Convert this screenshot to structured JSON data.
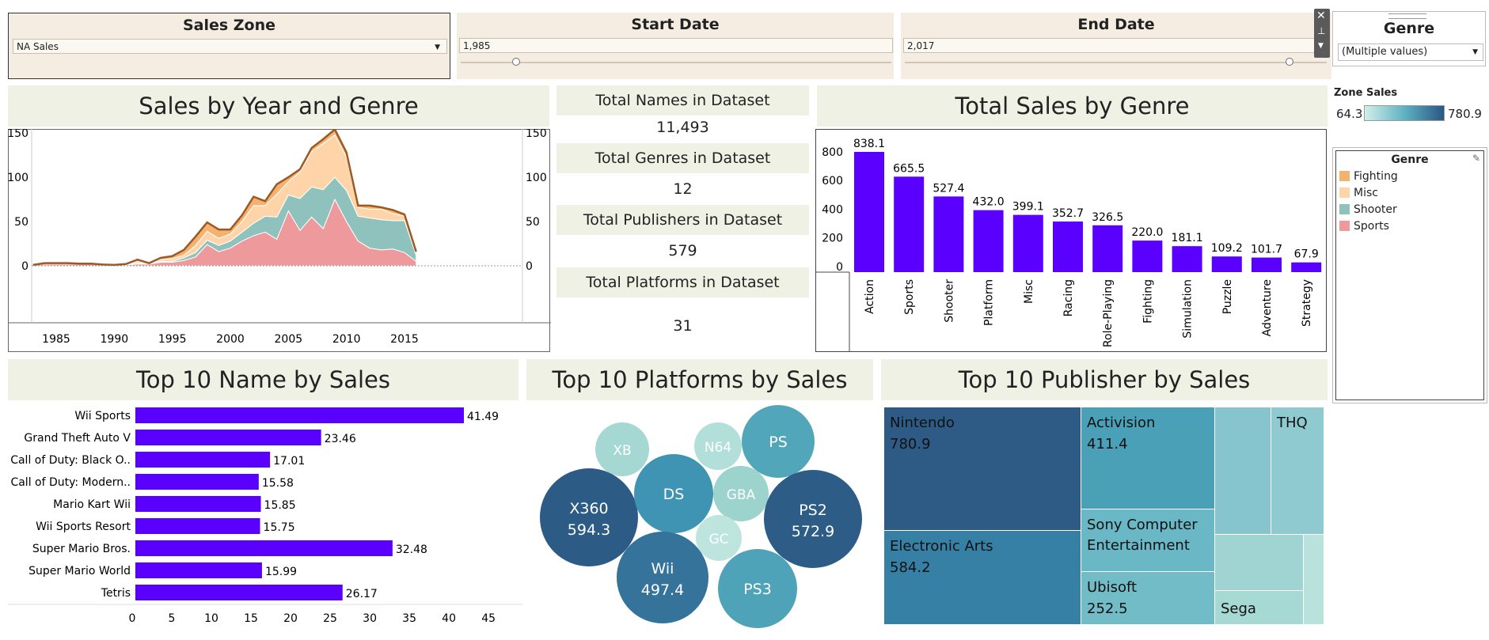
{
  "filters": {
    "sales_zone": {
      "title": "Sales Zone",
      "value": "NA Sales"
    },
    "start_date": {
      "title": "Start Date",
      "value": "1,985"
    },
    "end_date": {
      "title": "End Date",
      "value": "2,017"
    },
    "genre": {
      "title": "Genre",
      "value": "(Multiple values)"
    }
  },
  "zone_sales_legend": {
    "title": "Zone Sales",
    "min": "64.3",
    "max": "780.9",
    "color_low": "#d2eeea",
    "color_high": "#2a5783"
  },
  "genre_legend": {
    "title": "Genre",
    "items": [
      {
        "label": "Fighting",
        "color": "#f5b26e"
      },
      {
        "label": "Misc",
        "color": "#ffd4a8"
      },
      {
        "label": "Shooter",
        "color": "#8fc1bd"
      },
      {
        "label": "Sports",
        "color": "#ee9a9d"
      }
    ]
  },
  "kpis": [
    {
      "label": "Total Names in Dataset",
      "value": "11,493"
    },
    {
      "label": "Total Genres in Dataset",
      "value": "12"
    },
    {
      "label": "Total Publishers in Dataset",
      "value": "579"
    },
    {
      "label": "Total Platforms in Dataset",
      "value": "31"
    }
  ],
  "chart_data": [
    {
      "type": "area",
      "title": "Sales by Year and Genre",
      "xlim": [
        1981,
        2017
      ],
      "ylim": [
        -5,
        170
      ],
      "x_ticks": [
        "1985",
        "1990",
        "1995",
        "2000",
        "2005",
        "2010",
        "2015"
      ],
      "y_ticks": [
        "0",
        "50",
        "100",
        "150"
      ],
      "stacked": true,
      "x": [
        1983,
        1984,
        1985,
        1986,
        1987,
        1988,
        1989,
        1990,
        1991,
        1992,
        1993,
        1994,
        1995,
        1996,
        1997,
        1998,
        1999,
        2000,
        2001,
        2002,
        2003,
        2004,
        2005,
        2006,
        2007,
        2008,
        2009,
        2010,
        2011,
        2012,
        2013,
        2014,
        2015,
        2016
      ],
      "series": [
        {
          "name": "Sports",
          "color": "#ee9a9d",
          "values": [
            1,
            2,
            2,
            2,
            2,
            2,
            1,
            1,
            1,
            2,
            2,
            4,
            4,
            6,
            10,
            24,
            16,
            20,
            28,
            34,
            38,
            30,
            62,
            40,
            55,
            42,
            75,
            50,
            28,
            20,
            18,
            19,
            15,
            5
          ]
        },
        {
          "name": "Shooter",
          "color": "#8fc1bd",
          "values": [
            0,
            1,
            1,
            1,
            0.5,
            0.5,
            0.5,
            0,
            1,
            1,
            1,
            1,
            1,
            3,
            5,
            5,
            7,
            8,
            10,
            14,
            18,
            25,
            18,
            36,
            34,
            44,
            25,
            35,
            28,
            34,
            34,
            32,
            36,
            7
          ]
        },
        {
          "name": "Misc",
          "color": "#ffd4a8",
          "values": [
            0,
            0,
            0,
            0,
            0,
            0,
            0,
            0,
            0,
            2,
            0,
            2,
            3,
            3,
            8,
            10,
            8,
            8,
            12,
            20,
            12,
            26,
            15,
            30,
            40,
            52,
            48,
            38,
            10,
            10,
            12,
            8,
            5,
            3
          ]
        },
        {
          "name": "Fighting",
          "color": "#f5b26e",
          "values": [
            0,
            0,
            0,
            0,
            0,
            0,
            0,
            0,
            0,
            2,
            0,
            2,
            3,
            6,
            10,
            10,
            10,
            5,
            7,
            10,
            5,
            11,
            5,
            3,
            4,
            5,
            6,
            5,
            2,
            4,
            2,
            4,
            2,
            1
          ]
        }
      ]
    },
    {
      "type": "bar",
      "title": "Total Sales by Genre",
      "categories": [
        "Action",
        "Sports",
        "Shooter",
        "Platform",
        "Misc",
        "Racing",
        "Role-Playing",
        "Fighting",
        "Simulation",
        "Puzzle",
        "Adventure",
        "Strategy"
      ],
      "values": [
        838.1,
        665.5,
        527.4,
        432.0,
        399.1,
        352.7,
        326.5,
        220.0,
        181.1,
        109.2,
        101.7,
        67.9
      ],
      "data_labels": [
        "838.1",
        "665.5",
        "527.4",
        "432.0",
        "399.1",
        "352.7",
        "326.5",
        "220.0",
        "181.1",
        "109.2",
        "101.7",
        "67.9"
      ],
      "ylim": [
        0,
        900
      ],
      "y_ticks": [
        "0",
        "200",
        "400",
        "600",
        "800"
      ],
      "color": "#5a00ff"
    },
    {
      "type": "bar",
      "orientation": "horizontal",
      "title": "Top 10 Name by Sales",
      "categories": [
        "Wii Sports",
        "Grand Theft Auto V",
        "Call of Duty: Black O..",
        "Call of Duty: Modern..",
        "Mario Kart Wii",
        "Wii Sports Resort",
        "Super Mario Bros.",
        "Super Mario World",
        "Tetris"
      ],
      "values": [
        41.49,
        23.46,
        17.01,
        15.58,
        15.85,
        15.75,
        32.48,
        15.99,
        26.17
      ],
      "data_labels": [
        "41.49",
        "23.46",
        "17.01",
        "15.58",
        "15.85",
        "15.75",
        "32.48",
        "15.99",
        "26.17"
      ],
      "xlim": [
        0,
        48
      ],
      "x_ticks": [
        "0",
        "5",
        "10",
        "15",
        "20",
        "25",
        "30",
        "35",
        "40",
        "45"
      ],
      "color": "#5a00ff"
    },
    {
      "type": "bubble",
      "title": "Top 10 Platforms by Sales",
      "bubbles": [
        {
          "label": "XB",
          "value": 0,
          "value_label": "",
          "color": "#a6d8d3"
        },
        {
          "label": "N64",
          "value": 0,
          "value_label": "",
          "color": "#b2dfd9"
        },
        {
          "label": "PS",
          "value": 0,
          "value_label": "",
          "color": "#52a6b9"
        },
        {
          "label": "X360",
          "value": 594.3,
          "value_label": "594.3",
          "color": "#2c5b86"
        },
        {
          "label": "DS",
          "value": 0,
          "value_label": "",
          "color": "#3f94b3"
        },
        {
          "label": "GBA",
          "value": 0,
          "value_label": "",
          "color": "#9dd3cd"
        },
        {
          "label": "PS2",
          "value": 572.9,
          "value_label": "572.9",
          "color": "#2d5d87"
        },
        {
          "label": "GC",
          "value": 0,
          "value_label": "",
          "color": "#bde5de"
        },
        {
          "label": "Wii",
          "value": 497.4,
          "value_label": "497.4",
          "color": "#35739b"
        },
        {
          "label": "PS3",
          "value": 0,
          "value_label": "",
          "color": "#4fa3b8"
        }
      ]
    },
    {
      "type": "treemap",
      "title": "Top 10 Publisher by Sales",
      "tiles": [
        {
          "label": "Nintendo",
          "value_label": "780.9",
          "color": "#2d5b86"
        },
        {
          "label": "Electronic Arts",
          "value_label": "584.2",
          "color": "#3780a5"
        },
        {
          "label": "Activision",
          "value_label": "411.4",
          "color": "#4aa0b7"
        },
        {
          "label": "Sony Computer Entertainment",
          "value_label": "",
          "color": "#6ab8c6"
        },
        {
          "label": "Ubisoft",
          "value_label": "252.5",
          "color": "#72bcc8"
        },
        {
          "label": "",
          "value_label": "",
          "color": "#86c5ce"
        },
        {
          "label": "THQ",
          "value_label": "",
          "color": "#8fcad1"
        },
        {
          "label": "",
          "value_label": "",
          "color": "#9fd4d2"
        },
        {
          "label": "Sega",
          "value_label": "",
          "color": "#a6d8d4"
        },
        {
          "label": "",
          "value_label": "",
          "color": "#b8e2db"
        }
      ]
    }
  ]
}
